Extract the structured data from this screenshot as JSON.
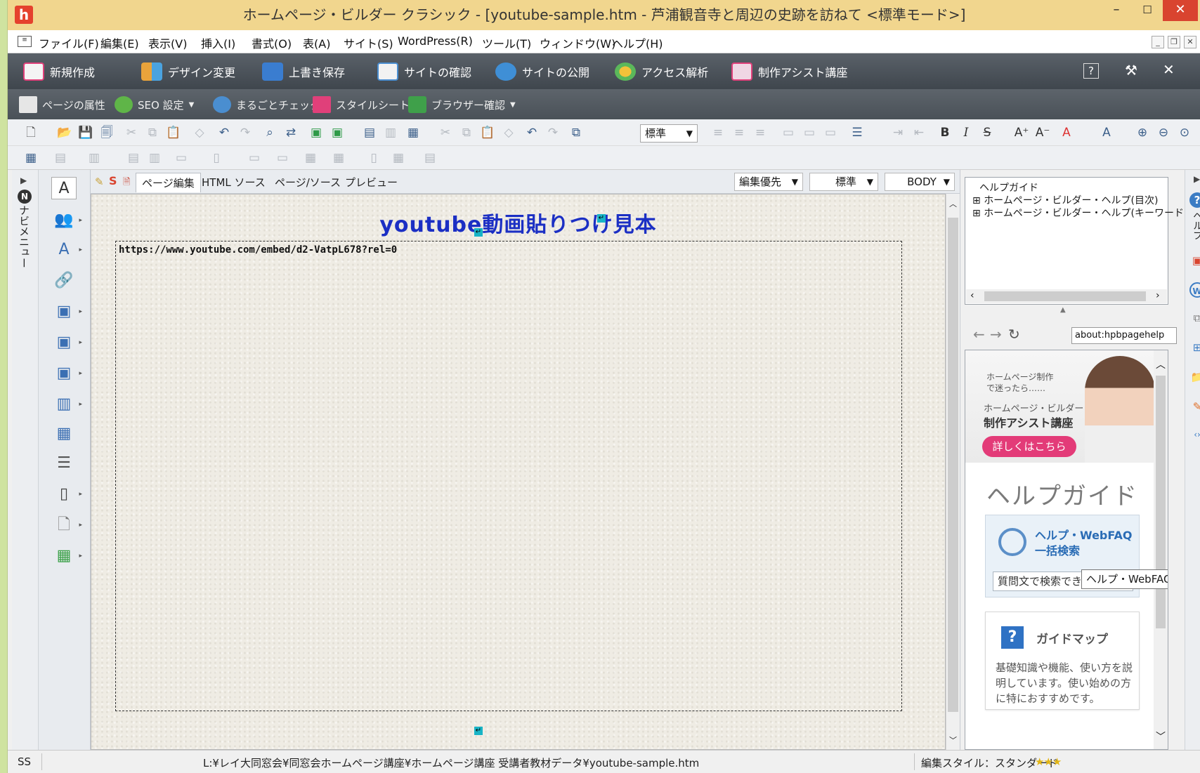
{
  "window": {
    "title": "ホームページ・ビルダー クラシック - [youtube-sample.htm - 芦浦観音寺と周辺の史跡を訪ねて <標準モード>]",
    "app_icon_letter": "h",
    "minimize": "–",
    "maximize": "☐",
    "close": "✕"
  },
  "menu": {
    "items": [
      "ファイル(F)",
      "編集(E)",
      "表示(V)",
      "挿入(I)",
      "書式(O)",
      "表(A)",
      "サイト(S)",
      "WordPress(R)",
      "ツール(T)",
      "ウィンドウ(W)",
      "ヘルプ(H)"
    ]
  },
  "main_toolbar": {
    "items": [
      "新規作成",
      "デザイン変更",
      "上書き保存",
      "サイトの確認",
      "サイトの公開",
      "アクセス解析",
      "制作アシスト講座"
    ],
    "help_icon": "?",
    "close_icon": "✕"
  },
  "sub_toolbar": {
    "items": [
      "ページの属性",
      "SEO 設定",
      "まるごとチェック",
      "スタイルシート",
      "ブラウザー確認"
    ]
  },
  "format_toolbar": {
    "paragraph_style": "標準"
  },
  "left_strip": {
    "label": "ナビメニュー"
  },
  "edit_tabs": {
    "tabs": [
      "ページ編集",
      "HTML ソース",
      "ページ/ソース",
      "プレビュー"
    ],
    "active": "ページ編集",
    "mode_select": "編集優先",
    "style_select": "標準",
    "tag_select": "BODY"
  },
  "editor": {
    "heading": "youtube動画貼りつけ見本",
    "embed_url": "https://www.youtube.com/embed/d2-VatpL678?rel=0"
  },
  "help_tree": {
    "root": "ヘルプガイド",
    "nodes": [
      "ホームページ・ビルダー・ヘルプ(目次)",
      "ホームページ・ビルダー・ヘルプ(キーワード)"
    ]
  },
  "help_nav": {
    "address": "about:hpbpagehelp"
  },
  "help_panel": {
    "banner_line1": "ホームページ制作",
    "banner_line2": "で迷ったら……",
    "banner_sub": "ホームページ・ビルダー",
    "banner_title": "制作アシスト講座",
    "banner_button": "詳しくはこちら",
    "guide_title": "ヘルプガイド",
    "search_label": "ヘルプ・WebFAQ一括検索",
    "search_placeholder": "質問文で検索できます",
    "tooltip": "ヘルプ・WebFAQ一括検",
    "map_title": "ガイドマップ",
    "map_desc": "基礎知識や機能、使い方を説明しています。使い始めの方に特におすすめです。"
  },
  "right_strip": {
    "label": "ヘルプ"
  },
  "status_bar": {
    "mode": "SS",
    "path": "L:¥レイ大同窓会¥同窓会ホームページ講座¥ホームページ講座 受講者教材データ¥youtube-sample.htm",
    "edit_style": "編集スタイル：スタンダード",
    "stars": "★★★"
  },
  "colors": {
    "titlebar": "#f1d68e",
    "toolbar_dark": "#4a5158",
    "heading_blue": "#1b2fc4",
    "banner_pink": "#e33b78",
    "help_blue": "#2a6cb5"
  }
}
